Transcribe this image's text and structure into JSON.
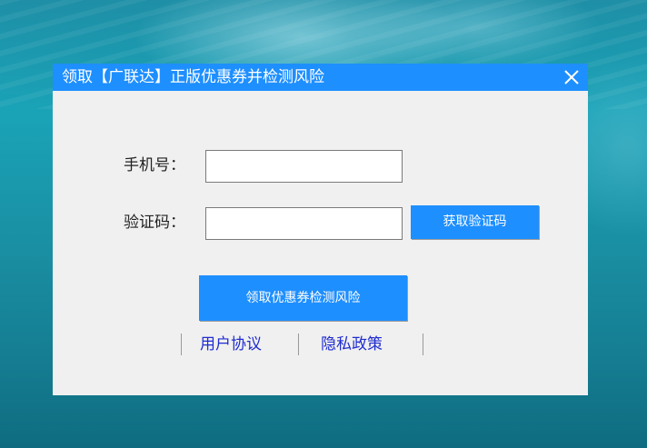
{
  "dialog": {
    "title": "领取【广联达】正版优惠券并检测风险",
    "close_icon": "close-icon"
  },
  "form": {
    "phone_label": "手机号：",
    "phone_value": "",
    "code_label": "验证码：",
    "code_value": "",
    "get_code_button": "获取验证码",
    "submit_button": "领取优惠券检测风险"
  },
  "links": {
    "user_agreement": "用户协议",
    "privacy_policy": "隐私政策"
  },
  "colors": {
    "accent": "#1e8fff",
    "link": "#1f2ccf",
    "dialog_bg": "#f0f0f0"
  }
}
